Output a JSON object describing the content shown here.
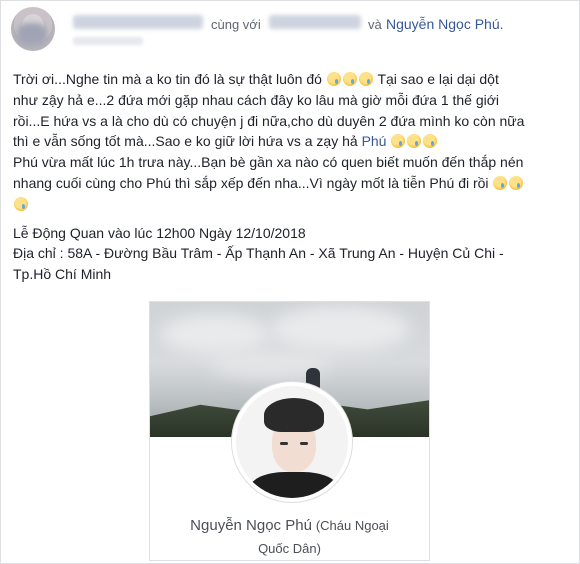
{
  "header": {
    "with_text": "cùng với",
    "and_text": "và",
    "tagged_name": "Nguyễn Ngọc Phú."
  },
  "post": {
    "line1_a": "Trời ơi...Nghe tin mà a ko tin đó là sự thật luôn đó",
    "line1_b": "Tại sao e lại dại dột",
    "line2": "như zậy hả e...2 đứa mới gặp nhau cách đây ko lâu mà giờ mỗi đứa 1 thế giới",
    "line3": "rồi...E hứa vs a là cho dù có chuyện j đi nữa,cho dù duyên 2 đứa mình ko còn nữa",
    "line4_a": "thì e vẫn sống tốt mà...Sao e ko giữ lời hứa vs a zạy hả",
    "line4_mention": "Phú",
    "line5": "Phú vừa mất lúc 1h trưa này...Bạn bè gần xa nào có quen biết muốn đến thắp nén",
    "line6": "nhang cuối cùng cho Phú thì sắp xếp đến nha...Vì ngày mốt là tiễn Phú đi rồi",
    "funeral": "Lễ Động Quan vào lúc 12h00 Ngày 12/10/2018",
    "address_1": "Địa chỉ : 58A - Đường Bầu Trâm - Ấp Thạnh An - Xã Trung An - Huyện Củ Chi -",
    "address_2": "Tp.Hồ Chí Minh"
  },
  "profile_card": {
    "name": "Nguyễn Ngọc Phú",
    "subtitle_1": "(Cháu Ngoại",
    "subtitle_2": "Quốc Dân)"
  },
  "icons": [
    "crying-face-emoji"
  ],
  "colors": {
    "link": "#365899",
    "text": "#1d2129",
    "secondary": "#606770"
  }
}
